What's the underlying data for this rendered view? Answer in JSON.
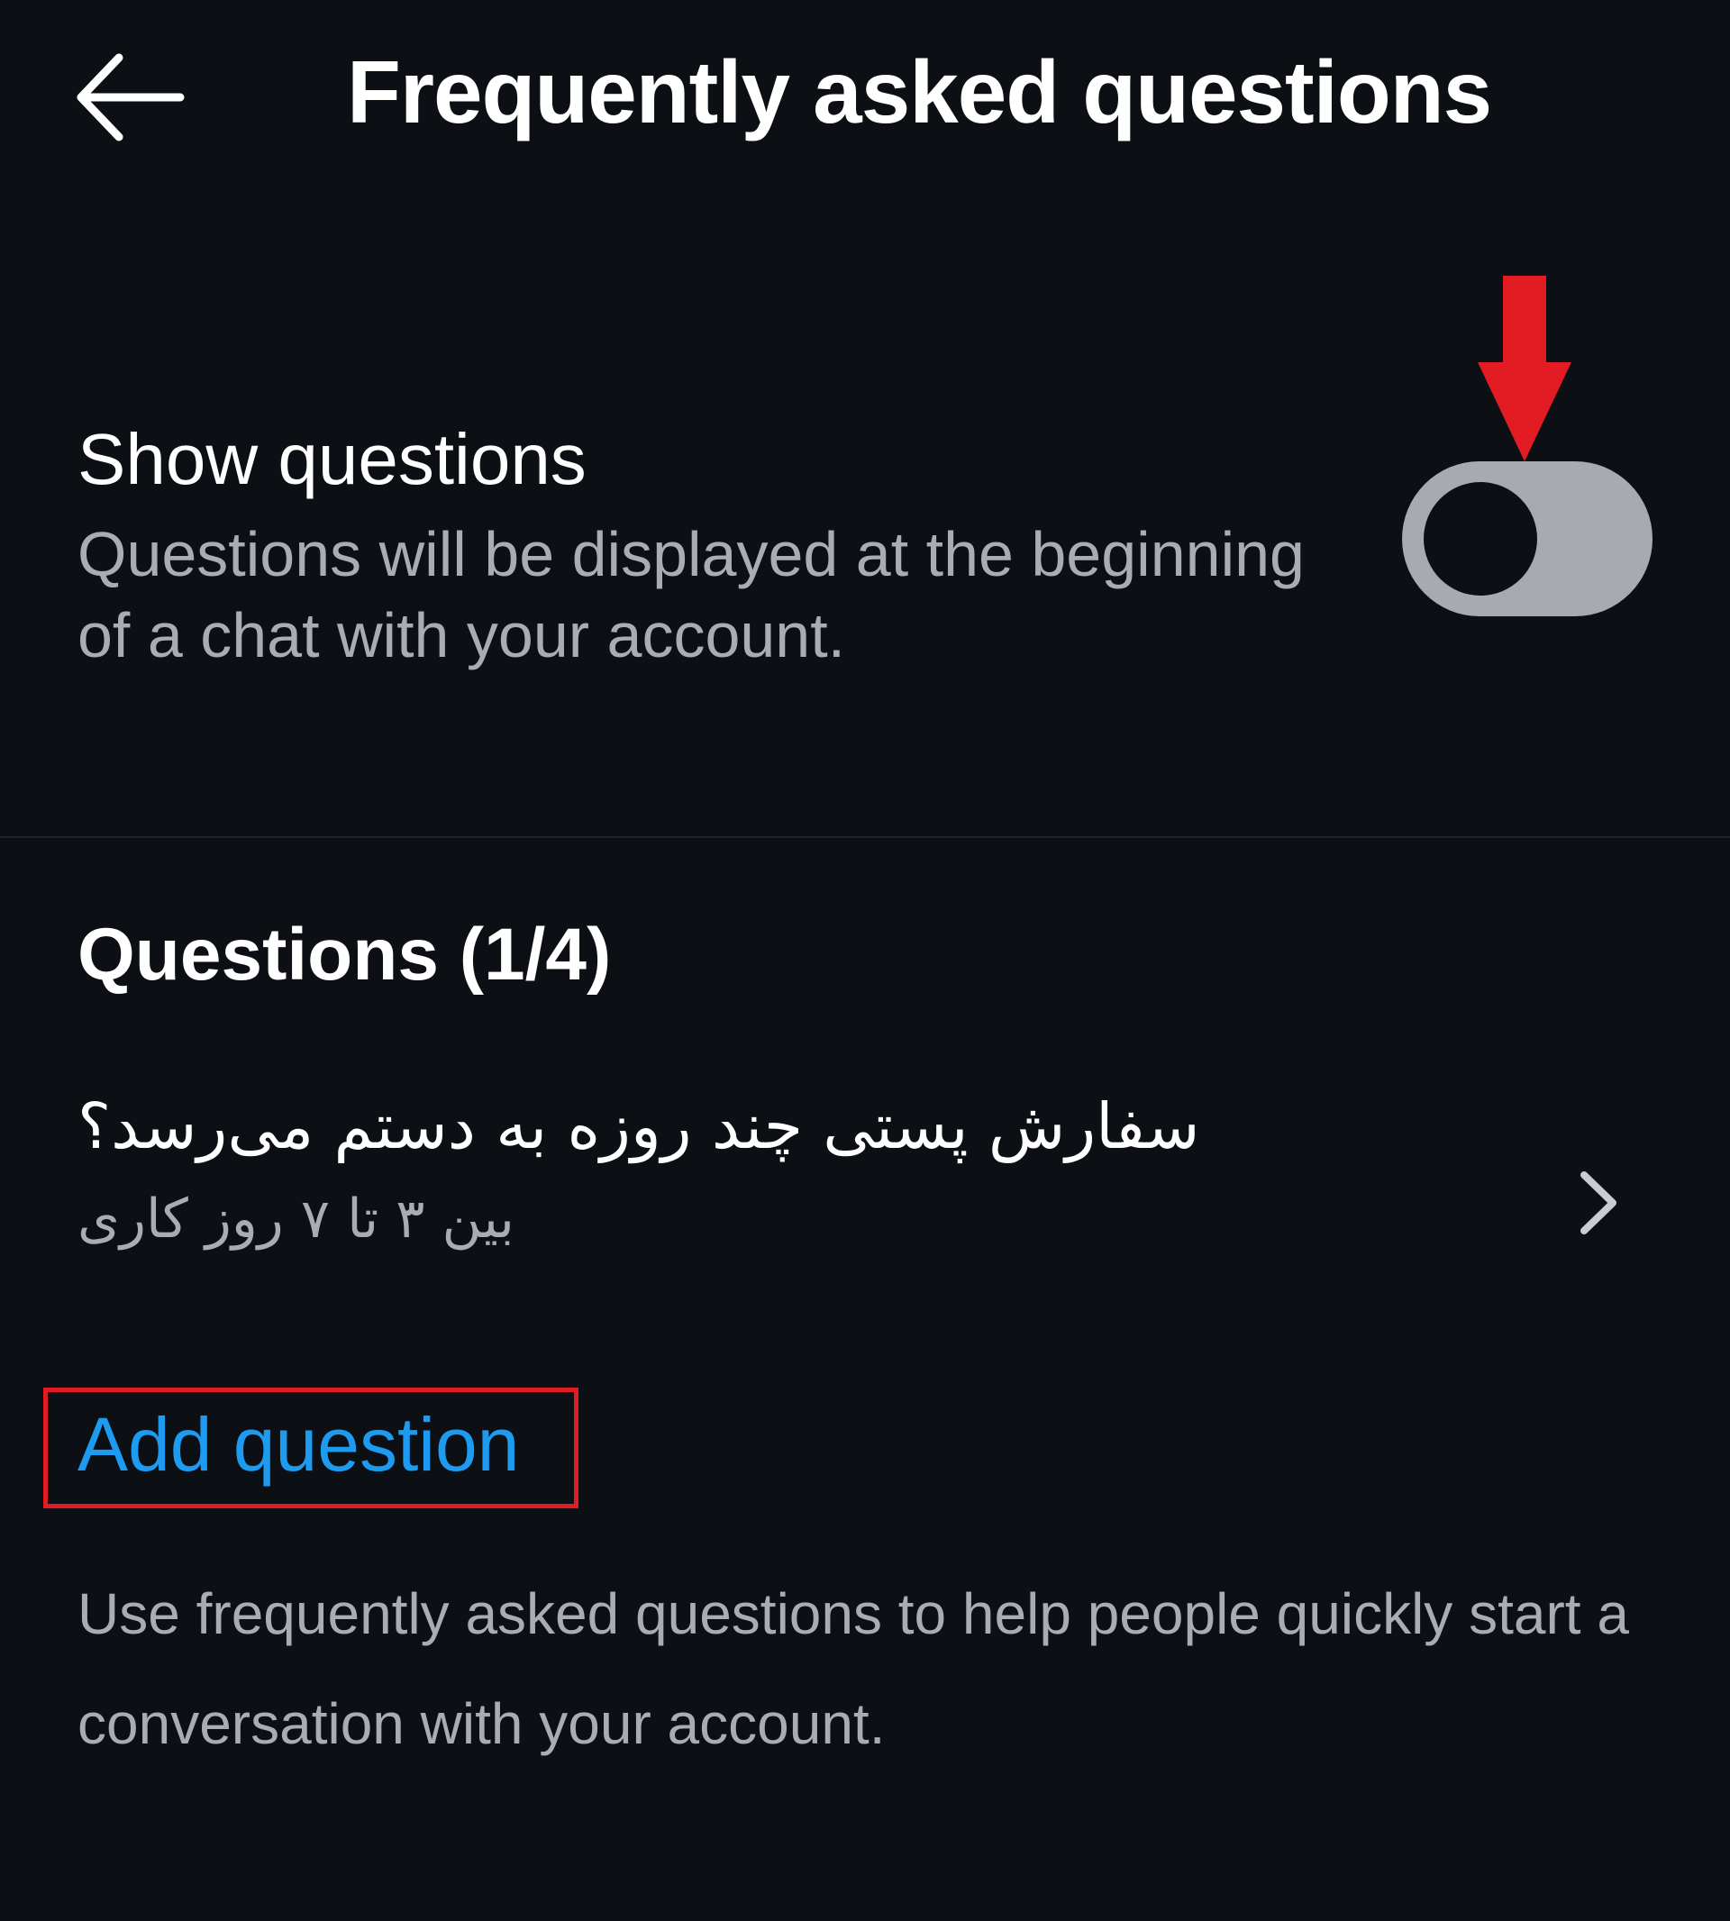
{
  "header": {
    "title": "Frequently asked questions",
    "back_icon": "arrow-left-icon"
  },
  "show_questions": {
    "title": "Show questions",
    "description": "Questions will be displayed at the beginning of a chat with your account.",
    "toggle_on": false,
    "annotation_color": "#e31b23"
  },
  "questions": {
    "heading": "Questions (1/4)",
    "items": [
      {
        "question": "سفارش پستی چند روزه به دستم می‌رسد؟",
        "answer": "بین ۳ تا ۷ روز کاری"
      }
    ]
  },
  "add_question": {
    "label": "Add question",
    "color": "#1d9bf0"
  },
  "help_text": "Use frequently asked questions to help people quickly start a conversation with your account."
}
